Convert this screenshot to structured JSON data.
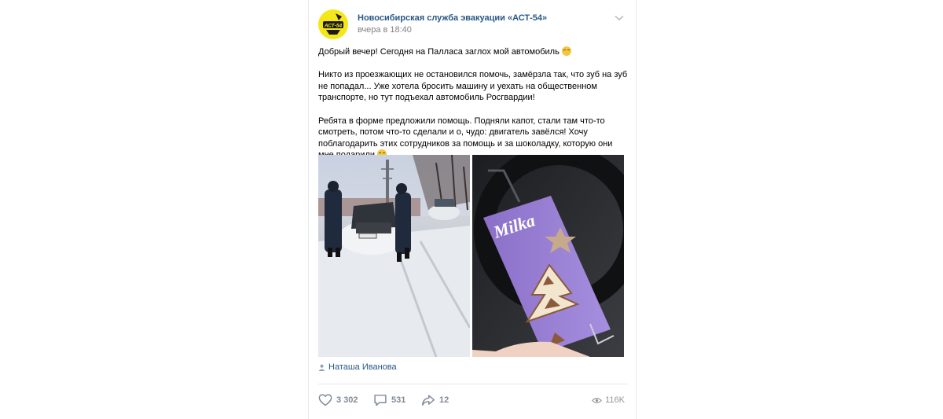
{
  "post": {
    "author": "Новосибирская служба эвакуации «АСТ-54»",
    "time": "вчера в 18:40",
    "avatar_text": "АСТ-54",
    "paragraphs": [
      "Добрый вечер! Сегодня на Палласа заглох мой автомобиль",
      "Никто из проезжающих не остановился помочь, замёрзла так, что зуб на зуб не попадал... Уже хотела бросить машину и уехать на общественном транспорте, но тут подъехал автомобиль Росгвардии!",
      "Ребята в форме предложили помощь. Подняли капот, стали там что-то смотреть, потом что-то сделали и о, чудо: двигатель завёлся! Хочу поблагодарить этих сотрудников за помощь и за шоколадку, которую они мне подарили"
    ],
    "photos": [
      {
        "name": "photo-police-car-snow"
      },
      {
        "name": "photo-milka-chocolate",
        "brand_text": "Milka"
      }
    ],
    "signer": "Наташа Иванова"
  },
  "actions": {
    "likes": "3 302",
    "comments": "531",
    "shares": "12",
    "views": "116K"
  },
  "icons": {
    "more": "chevron-down-icon",
    "like": "heart-icon",
    "comment": "comment-icon",
    "share": "share-arrow-icon",
    "views": "eye-icon",
    "signer": "person-icon"
  },
  "colors": {
    "link": "#2a5885",
    "secondary": "#828282",
    "action": "#828a99",
    "avatar_bg": "#f5e61a",
    "divider": "#e7e8ec"
  }
}
